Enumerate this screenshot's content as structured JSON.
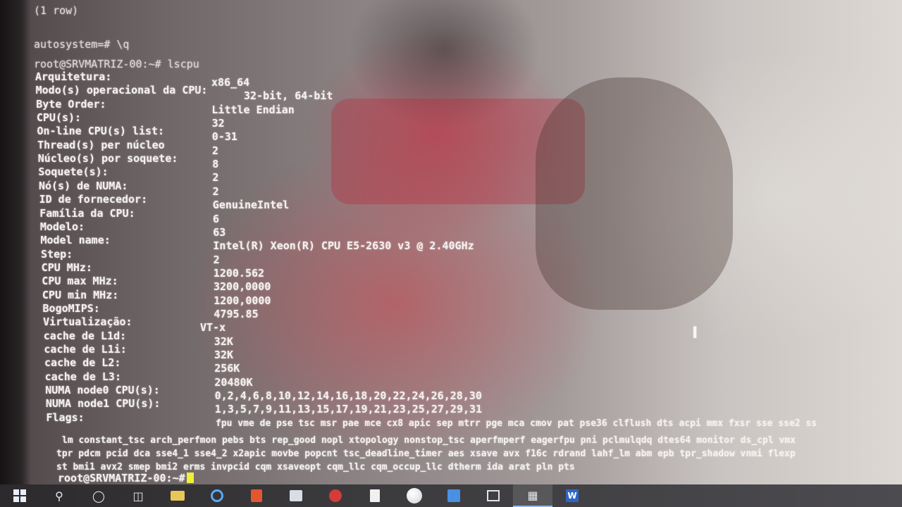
{
  "terminal": {
    "top_line": "(1 row)",
    "psql_quit": "autosystem=# \\q",
    "prompt_cmd": "root@SRVMATRIZ-00:~# lscpu",
    "lscpu": [
      {
        "key": "Arquitetura:",
        "value": "x86_64"
      },
      {
        "key": "Modo(s) operacional da CPU:",
        "value": "32-bit, 64-bit"
      },
      {
        "key": "Byte Order:",
        "value": "Little Endian"
      },
      {
        "key": "CPU(s):",
        "value": "32"
      },
      {
        "key": "On-line CPU(s) list:",
        "value": "0-31"
      },
      {
        "key": "Thread(s) per núcleo",
        "value": "2"
      },
      {
        "key": "Núcleo(s) por soquete:",
        "value": "8"
      },
      {
        "key": "Soquete(s):",
        "value": "2"
      },
      {
        "key": "Nó(s) de NUMA:",
        "value": "2"
      },
      {
        "key": "ID de fornecedor:",
        "value": "GenuineIntel"
      },
      {
        "key": "Família da CPU:",
        "value": "6"
      },
      {
        "key": "Modelo:",
        "value": "63"
      },
      {
        "key": "Model name:",
        "value": "Intel(R) Xeon(R) CPU E5-2630 v3 @ 2.40GHz"
      },
      {
        "key": "Step:",
        "value": "2"
      },
      {
        "key": "CPU MHz:",
        "value": "1200.562"
      },
      {
        "key": "CPU max MHz:",
        "value": "3200,0000"
      },
      {
        "key": "CPU min MHz:",
        "value": "1200,0000"
      },
      {
        "key": "BogoMIPS:",
        "value": "4795.85"
      },
      {
        "key": "Virtualização:",
        "value": "VT-x"
      },
      {
        "key": "cache de L1d:",
        "value": "32K"
      },
      {
        "key": "cache de L1i:",
        "value": "32K"
      },
      {
        "key": "cache de L2:",
        "value": "256K"
      },
      {
        "key": "cache de L3:",
        "value": "20480K"
      },
      {
        "key": "NUMA node0 CPU(s):",
        "value": "0,2,4,6,8,10,12,14,16,18,20,22,24,26,28,30"
      },
      {
        "key": "NUMA node1 CPU(s):",
        "value": "1,3,5,7,9,11,13,15,17,19,21,23,25,27,29,31"
      },
      {
        "key": "Flags:",
        "value": "fpu vme de pse tsc msr pae mce cx8 apic sep mtrr pge mca cmov pat pse36 clflush dts acpi mmx fxsr sse sse2 ss"
      }
    ],
    "flags_cont": [
      "lm constant_tsc arch_perfmon pebs bts rep_good nopl xtopology nonstop_tsc aperfmperf eagerfpu pni pclmulqdq dtes64 monitor ds_cpl vmx",
      "tpr pdcm pcid dca sse4_1 sse4_2 x2apic movbe popcnt tsc_deadline_timer aes xsave avx f16c rdrand lahf_lm abm epb tpr_shadow vnmi flexp",
      "st bmi1 avx2 smep bmi2 erms invpcid cqm xsaveopt cqm_llc cqm_occup_llc dtherm ida arat pln pts"
    ],
    "final_prompt": "root@SRVMATRIZ-00:~#"
  },
  "taskbar": {
    "items": [
      {
        "icon": "windows-start-icon"
      },
      {
        "icon": "search-icon"
      },
      {
        "icon": "cortana-icon"
      },
      {
        "icon": "task-view-icon"
      },
      {
        "icon": "file-explorer-icon"
      },
      {
        "icon": "edge-browser-icon"
      },
      {
        "icon": "office-icon"
      },
      {
        "icon": "store-icon"
      },
      {
        "icon": "app-icon"
      },
      {
        "icon": "document-icon"
      },
      {
        "icon": "sphere-app-icon"
      },
      {
        "icon": "blue-app-icon"
      },
      {
        "icon": "network-app-icon"
      },
      {
        "icon": "terminal-app-icon"
      },
      {
        "icon": "word-icon",
        "label": "W"
      }
    ]
  }
}
